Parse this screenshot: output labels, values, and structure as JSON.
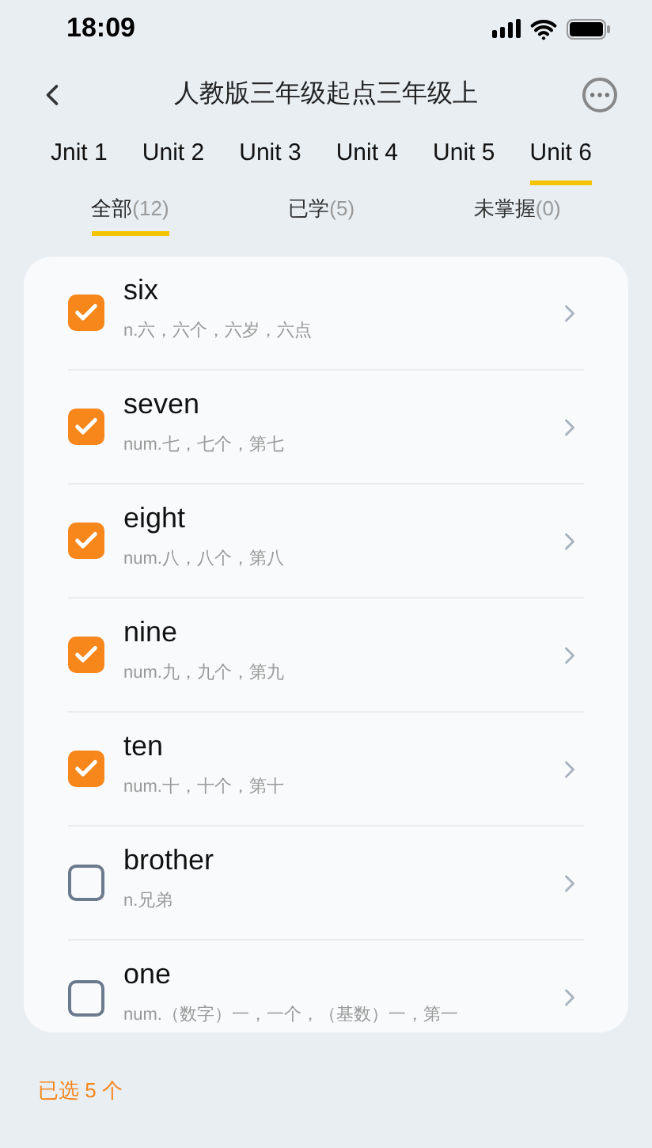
{
  "status_bar": {
    "time": "18:09"
  },
  "header": {
    "title": "人教版三年级起点三年级上"
  },
  "unit_tabs": [
    {
      "label": "Jnit 1",
      "selected": false
    },
    {
      "label": "Unit 2",
      "selected": false
    },
    {
      "label": "Unit 3",
      "selected": false
    },
    {
      "label": "Unit 4",
      "selected": false
    },
    {
      "label": "Unit 5",
      "selected": false
    },
    {
      "label": "Unit 6",
      "selected": true
    }
  ],
  "filter_tabs": [
    {
      "label": "全部",
      "count": "(12)",
      "selected": true
    },
    {
      "label": "已学",
      "count": "(5)",
      "selected": false
    },
    {
      "label": "未掌握",
      "count": "(0)",
      "selected": false
    }
  ],
  "words": [
    {
      "word": "six",
      "meaning": "n.六，六个，六岁，六点",
      "checked": true
    },
    {
      "word": "seven",
      "meaning": "num.七，七个，第七",
      "checked": true
    },
    {
      "word": "eight",
      "meaning": "num.八，八个，第八",
      "checked": true
    },
    {
      "word": "nine",
      "meaning": "num.九，九个，第九",
      "checked": true
    },
    {
      "word": "ten",
      "meaning": "num.十，十个，第十",
      "checked": true
    },
    {
      "word": "brother",
      "meaning": "n.兄弟",
      "checked": false
    },
    {
      "word": "one",
      "meaning": "num.（数字）一，一个，（基数）一，第一",
      "checked": false
    }
  ],
  "footer": {
    "selected_count": "已选 5 个"
  }
}
